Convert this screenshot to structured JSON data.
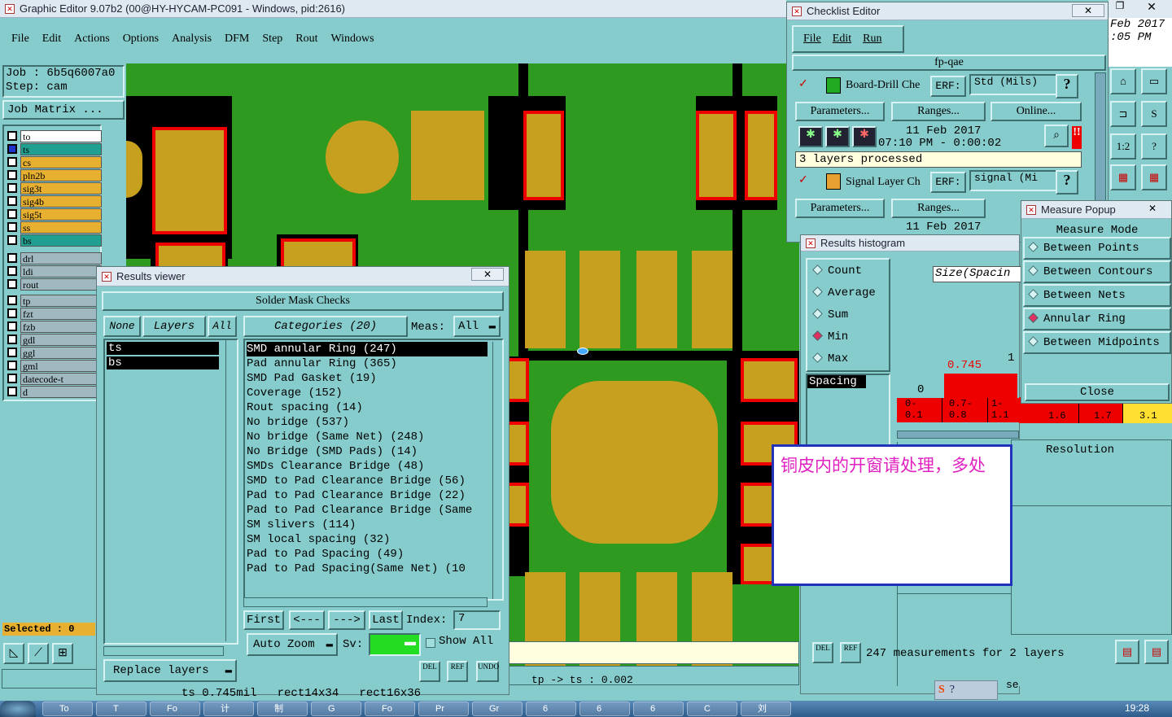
{
  "main_window": {
    "title": "Graphic Editor 9.07b2 (00@HY-HYCAM-PC091 - Windows, pid:2616)",
    "menu": [
      "File",
      "Edit",
      "Actions",
      "Options",
      "Analysis",
      "DFM",
      "Step",
      "Rout",
      "Windows"
    ],
    "job_label": "Job : 6b5q6007a0",
    "step_label": "Step: cam",
    "job_matrix_button": "Job Matrix ...",
    "layers": [
      {
        "name": "to",
        "color": "#ffffff"
      },
      {
        "name": "ts",
        "color": "#20a090"
      },
      {
        "name": "cs",
        "color": "#e8b030"
      },
      {
        "name": "pln2b",
        "color": "#e8b030"
      },
      {
        "name": "sig3t",
        "color": "#e8b030"
      },
      {
        "name": "sig4b",
        "color": "#e8b030"
      },
      {
        "name": "sig5t",
        "color": "#e8b030"
      },
      {
        "name": "ss",
        "color": "#e8b030"
      },
      {
        "name": "bs",
        "color": "#20a090"
      },
      {
        "name": "drl",
        "color": "#a0b8c0"
      },
      {
        "name": "ldi",
        "color": "#a0b8c0"
      },
      {
        "name": "rout",
        "color": "#a0b8c0"
      },
      {
        "name": "tp",
        "color": "#a0b8c0"
      },
      {
        "name": "fzt",
        "color": "#a0b8c0"
      },
      {
        "name": "fzb",
        "color": "#a0b8c0"
      },
      {
        "name": "gdl",
        "color": "#a0b8c0"
      },
      {
        "name": "ggl",
        "color": "#a0b8c0"
      },
      {
        "name": "gml",
        "color": "#a0b8c0"
      },
      {
        "name": "datecode-t",
        "color": "#a0b8c0"
      },
      {
        "name": "d",
        "color": "#a0b8c0"
      }
    ],
    "selected_label": "Selected : 0",
    "status_measure": "tp -> ts : 0.002",
    "date_partial": "Feb 2017",
    "time_partial": ":05 PM"
  },
  "checklist_editor": {
    "title": "Checklist Editor",
    "menu": [
      "File",
      "Edit",
      "Run"
    ],
    "checklist_name": "fp-qae",
    "actions": [
      {
        "name": "Board-Drill Che",
        "erf_label": "ERF:",
        "erf_value": "Std (Mils)",
        "date": "11 Feb 2017",
        "time": "07:10 PM - 0:00:02",
        "status": "3 layers processed"
      },
      {
        "name": "Signal Layer Ch",
        "erf_label": "ERF:",
        "erf_value": "signal (Mi",
        "date": "11 Feb 2017"
      }
    ],
    "parameters_button": "Parameters...",
    "ranges_button": "Ranges...",
    "online_button": "Online...",
    "help_glyph": "?"
  },
  "results_viewer": {
    "title": "Results viewer",
    "header": "Solder Mask Checks",
    "none_button": "None",
    "layers_button": "Layers",
    "all_button": "All",
    "categories_button": "Categories (20)",
    "meas_label": "Meas:",
    "meas_value": "All",
    "layer_list": [
      "ts",
      "bs"
    ],
    "categories": [
      "SMD annular Ring (247)",
      "Pad annular Ring (365)",
      "SMD Pad Gasket (19)",
      "Coverage (152)",
      "Rout spacing (14)",
      "No bridge (537)",
      "No bridge (Same Net) (248)",
      "No Bridge (SMD Pads) (14)",
      "SMDs Clearance Bridge (48)",
      "SMD to Pad Clearance Bridge (56)",
      "Pad to Pad Clearance Bridge (22)",
      "Pad to Pad Clearance Bridge (Same",
      "SM slivers (114)",
      "SM local spacing (32)",
      "Pad to Pad Spacing (49)",
      "Pad to Pad Spacing(Same Net) (10"
    ],
    "first_button": "First",
    "prev_button": "<---",
    "next_button": "--->",
    "last_button": "Last",
    "index_label": "Index:",
    "index_value": "7",
    "auto_zoom": "Auto Zoom",
    "sv_label": "Sv:",
    "show_all": "Show All",
    "replace_layers": "Replace layers",
    "del_label": "DEL",
    "ref_label": "REF",
    "undo_label": "UNDO",
    "status": "ts 0.745mil   rect14x34   rect16x36"
  },
  "histogram": {
    "title": "Results histogram",
    "options": [
      {
        "label": "Count",
        "selected": false
      },
      {
        "label": "Average",
        "selected": false
      },
      {
        "label": "Sum",
        "selected": false
      },
      {
        "label": "Min",
        "selected": true
      },
      {
        "label": "Max",
        "selected": false
      }
    ],
    "field": "Spacing",
    "header": "Size(Spacin",
    "bar_value_label": "0.745",
    "zero_label": "0",
    "one_label": "1",
    "bins": [
      "0-\n0.1",
      "0.7-\n0.8",
      "1-\n1.1",
      "1.6",
      "1.7",
      "3.1"
    ],
    "resolution_label": "Resolution",
    "footer_text": "247 measurements for 2 layers",
    "se_partial": "se"
  },
  "measure_popup": {
    "title": "Measure Popup",
    "header": "Measure Mode",
    "modes": [
      {
        "label": "Between Points",
        "selected": false
      },
      {
        "label": "Between Contours",
        "selected": false
      },
      {
        "label": "Between Nets",
        "selected": false
      },
      {
        "label": "Annular Ring",
        "selected": true
      },
      {
        "label": "Between Midpoints",
        "selected": false
      }
    ],
    "close_button": "Close"
  },
  "note": {
    "text": "铜皮内的开窗请处理，多处"
  },
  "taskbar": {
    "clock": "19:28",
    "items": [
      "To",
      "T",
      "Fo",
      "计",
      "制",
      "G",
      "Fo",
      "Pr",
      "Gr",
      "6",
      "6",
      "6",
      "C",
      "刘"
    ]
  },
  "colors": {
    "panel": "#86cccc",
    "board_green": "#2e9a20",
    "pad_gold": "#c8a020",
    "mask_red": "#e00000"
  }
}
